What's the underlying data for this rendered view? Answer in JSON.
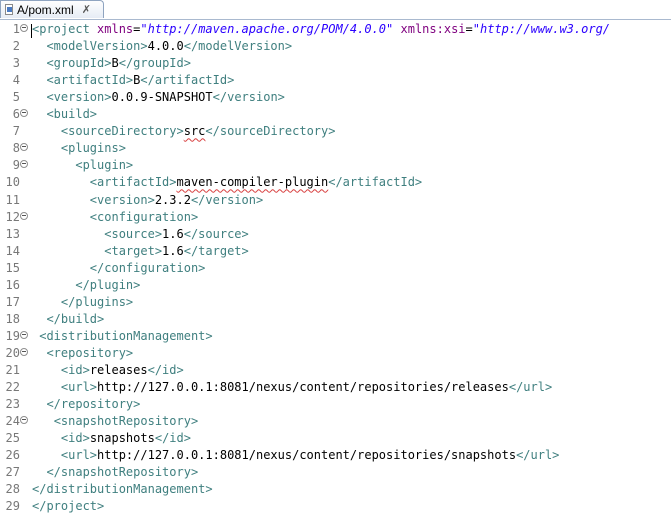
{
  "tab": {
    "label": "A/pom.xml",
    "close_glyph": "✗"
  },
  "lines": [
    {
      "n": "1",
      "fold": true,
      "indent": "",
      "parts": [
        [
          "t",
          "<project "
        ],
        [
          "a",
          "xmlns"
        ],
        [
          "s",
          "="
        ],
        [
          "v",
          "\"http://maven.apache.org/POM/4.0.0\""
        ],
        [
          "s",
          " "
        ],
        [
          "a",
          "xmlns:xsi"
        ],
        [
          "s",
          "="
        ],
        [
          "v",
          "\"http://www.w3.org/"
        ]
      ]
    },
    {
      "n": "2",
      "fold": false,
      "indent": "  ",
      "parts": [
        [
          "t",
          "<modelVersion>"
        ],
        [
          "s",
          "4.0.0"
        ],
        [
          "t",
          "</modelVersion>"
        ]
      ]
    },
    {
      "n": "3",
      "fold": false,
      "indent": "  ",
      "parts": [
        [
          "t",
          "<groupId>"
        ],
        [
          "s",
          "B"
        ],
        [
          "t",
          "</groupId>"
        ]
      ]
    },
    {
      "n": "4",
      "fold": false,
      "indent": "  ",
      "parts": [
        [
          "t",
          "<artifactId>"
        ],
        [
          "s",
          "B"
        ],
        [
          "t",
          "</artifactId>"
        ]
      ]
    },
    {
      "n": "5",
      "fold": false,
      "indent": "  ",
      "parts": [
        [
          "t",
          "<version>"
        ],
        [
          "s",
          "0.0.9-SNAPSHOT"
        ],
        [
          "t",
          "</version>"
        ]
      ]
    },
    {
      "n": "6",
      "fold": true,
      "indent": "  ",
      "parts": [
        [
          "t",
          "<build>"
        ]
      ]
    },
    {
      "n": "7",
      "fold": false,
      "indent": "    ",
      "parts": [
        [
          "t",
          "<sourceDirectory>"
        ],
        [
          "sq",
          "src"
        ],
        [
          "t",
          "</sourceDirectory>"
        ]
      ]
    },
    {
      "n": "8",
      "fold": true,
      "indent": "    ",
      "parts": [
        [
          "t",
          "<plugins>"
        ]
      ]
    },
    {
      "n": "9",
      "fold": true,
      "indent": "      ",
      "parts": [
        [
          "t",
          "<plugin>"
        ]
      ]
    },
    {
      "n": "10",
      "fold": false,
      "indent": "        ",
      "parts": [
        [
          "t",
          "<artifactId>"
        ],
        [
          "sq",
          "maven-compiler-plugin"
        ],
        [
          "t",
          "</artifactId>"
        ]
      ]
    },
    {
      "n": "11",
      "fold": false,
      "indent": "        ",
      "parts": [
        [
          "t",
          "<version>"
        ],
        [
          "s",
          "2.3.2"
        ],
        [
          "t",
          "</version>"
        ]
      ]
    },
    {
      "n": "12",
      "fold": true,
      "indent": "        ",
      "parts": [
        [
          "t",
          "<configuration>"
        ]
      ]
    },
    {
      "n": "13",
      "fold": false,
      "indent": "          ",
      "parts": [
        [
          "t",
          "<source>"
        ],
        [
          "s",
          "1.6"
        ],
        [
          "t",
          "</source>"
        ]
      ]
    },
    {
      "n": "14",
      "fold": false,
      "indent": "          ",
      "parts": [
        [
          "t",
          "<target>"
        ],
        [
          "s",
          "1.6"
        ],
        [
          "t",
          "</target>"
        ]
      ]
    },
    {
      "n": "15",
      "fold": false,
      "indent": "        ",
      "parts": [
        [
          "t",
          "</configuration>"
        ]
      ]
    },
    {
      "n": "16",
      "fold": false,
      "indent": "      ",
      "parts": [
        [
          "t",
          "</plugin>"
        ]
      ]
    },
    {
      "n": "17",
      "fold": false,
      "indent": "    ",
      "parts": [
        [
          "t",
          "</plugins>"
        ]
      ]
    },
    {
      "n": "18",
      "fold": false,
      "indent": "  ",
      "parts": [
        [
          "t",
          "</build>"
        ]
      ]
    },
    {
      "n": "19",
      "fold": true,
      "indent": " ",
      "parts": [
        [
          "t",
          "<distributionManagement>"
        ]
      ]
    },
    {
      "n": "20",
      "fold": true,
      "indent": "  ",
      "parts": [
        [
          "t",
          "<repository>"
        ]
      ]
    },
    {
      "n": "21",
      "fold": false,
      "indent": "    ",
      "parts": [
        [
          "t",
          "<id>"
        ],
        [
          "s",
          "releases"
        ],
        [
          "t",
          "</id>"
        ]
      ]
    },
    {
      "n": "22",
      "fold": false,
      "indent": "    ",
      "parts": [
        [
          "t",
          "<url>"
        ],
        [
          "s",
          "http://127.0.0.1:8081/nexus/content/repositories/releases"
        ],
        [
          "t",
          "</url>"
        ]
      ]
    },
    {
      "n": "23",
      "fold": false,
      "indent": "  ",
      "parts": [
        [
          "t",
          "</repository>"
        ]
      ]
    },
    {
      "n": "24",
      "fold": true,
      "indent": "   ",
      "parts": [
        [
          "t",
          "<snapshotRepository>"
        ]
      ]
    },
    {
      "n": "25",
      "fold": false,
      "indent": "    ",
      "parts": [
        [
          "t",
          "<id>"
        ],
        [
          "s",
          "snapshots"
        ],
        [
          "t",
          "</id>"
        ]
      ]
    },
    {
      "n": "26",
      "fold": false,
      "indent": "    ",
      "parts": [
        [
          "t",
          "<url>"
        ],
        [
          "s",
          "http://127.0.0.1:8081/nexus/content/repositories/snapshots"
        ],
        [
          "t",
          "</url>"
        ]
      ]
    },
    {
      "n": "27",
      "fold": false,
      "indent": "  ",
      "parts": [
        [
          "t",
          "</snapshotRepository>"
        ]
      ]
    },
    {
      "n": "28",
      "fold": false,
      "indent": "",
      "parts": [
        [
          "t",
          "</distributionManagement>"
        ]
      ]
    },
    {
      "n": "29",
      "fold": false,
      "indent": "",
      "parts": [
        [
          "t",
          "</project>"
        ]
      ]
    }
  ]
}
